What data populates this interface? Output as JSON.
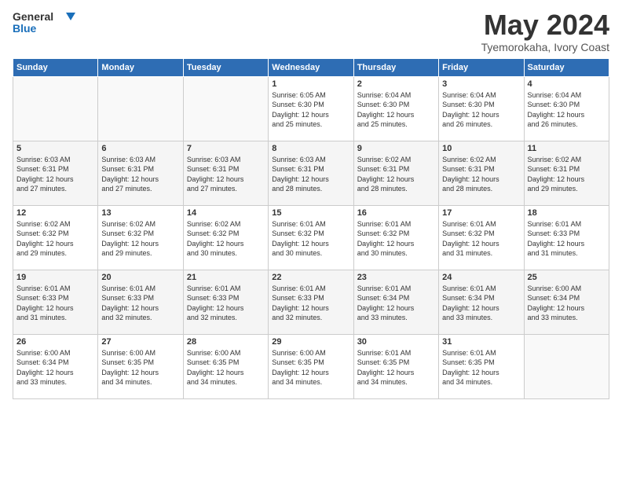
{
  "header": {
    "logo_line1": "General",
    "logo_line2": "Blue",
    "title": "May 2024",
    "subtitle": "Tyemorokaha, Ivory Coast"
  },
  "days_of_week": [
    "Sunday",
    "Monday",
    "Tuesday",
    "Wednesday",
    "Thursday",
    "Friday",
    "Saturday"
  ],
  "weeks": [
    [
      {
        "day": "",
        "content": ""
      },
      {
        "day": "",
        "content": ""
      },
      {
        "day": "",
        "content": ""
      },
      {
        "day": "1",
        "content": "Sunrise: 6:05 AM\nSunset: 6:30 PM\nDaylight: 12 hours\nand 25 minutes."
      },
      {
        "day": "2",
        "content": "Sunrise: 6:04 AM\nSunset: 6:30 PM\nDaylight: 12 hours\nand 25 minutes."
      },
      {
        "day": "3",
        "content": "Sunrise: 6:04 AM\nSunset: 6:30 PM\nDaylight: 12 hours\nand 26 minutes."
      },
      {
        "day": "4",
        "content": "Sunrise: 6:04 AM\nSunset: 6:30 PM\nDaylight: 12 hours\nand 26 minutes."
      }
    ],
    [
      {
        "day": "5",
        "content": "Sunrise: 6:03 AM\nSunset: 6:31 PM\nDaylight: 12 hours\nand 27 minutes."
      },
      {
        "day": "6",
        "content": "Sunrise: 6:03 AM\nSunset: 6:31 PM\nDaylight: 12 hours\nand 27 minutes."
      },
      {
        "day": "7",
        "content": "Sunrise: 6:03 AM\nSunset: 6:31 PM\nDaylight: 12 hours\nand 27 minutes."
      },
      {
        "day": "8",
        "content": "Sunrise: 6:03 AM\nSunset: 6:31 PM\nDaylight: 12 hours\nand 28 minutes."
      },
      {
        "day": "9",
        "content": "Sunrise: 6:02 AM\nSunset: 6:31 PM\nDaylight: 12 hours\nand 28 minutes."
      },
      {
        "day": "10",
        "content": "Sunrise: 6:02 AM\nSunset: 6:31 PM\nDaylight: 12 hours\nand 28 minutes."
      },
      {
        "day": "11",
        "content": "Sunrise: 6:02 AM\nSunset: 6:31 PM\nDaylight: 12 hours\nand 29 minutes."
      }
    ],
    [
      {
        "day": "12",
        "content": "Sunrise: 6:02 AM\nSunset: 6:32 PM\nDaylight: 12 hours\nand 29 minutes."
      },
      {
        "day": "13",
        "content": "Sunrise: 6:02 AM\nSunset: 6:32 PM\nDaylight: 12 hours\nand 29 minutes."
      },
      {
        "day": "14",
        "content": "Sunrise: 6:02 AM\nSunset: 6:32 PM\nDaylight: 12 hours\nand 30 minutes."
      },
      {
        "day": "15",
        "content": "Sunrise: 6:01 AM\nSunset: 6:32 PM\nDaylight: 12 hours\nand 30 minutes."
      },
      {
        "day": "16",
        "content": "Sunrise: 6:01 AM\nSunset: 6:32 PM\nDaylight: 12 hours\nand 30 minutes."
      },
      {
        "day": "17",
        "content": "Sunrise: 6:01 AM\nSunset: 6:32 PM\nDaylight: 12 hours\nand 31 minutes."
      },
      {
        "day": "18",
        "content": "Sunrise: 6:01 AM\nSunset: 6:33 PM\nDaylight: 12 hours\nand 31 minutes."
      }
    ],
    [
      {
        "day": "19",
        "content": "Sunrise: 6:01 AM\nSunset: 6:33 PM\nDaylight: 12 hours\nand 31 minutes."
      },
      {
        "day": "20",
        "content": "Sunrise: 6:01 AM\nSunset: 6:33 PM\nDaylight: 12 hours\nand 32 minutes."
      },
      {
        "day": "21",
        "content": "Sunrise: 6:01 AM\nSunset: 6:33 PM\nDaylight: 12 hours\nand 32 minutes."
      },
      {
        "day": "22",
        "content": "Sunrise: 6:01 AM\nSunset: 6:33 PM\nDaylight: 12 hours\nand 32 minutes."
      },
      {
        "day": "23",
        "content": "Sunrise: 6:01 AM\nSunset: 6:34 PM\nDaylight: 12 hours\nand 33 minutes."
      },
      {
        "day": "24",
        "content": "Sunrise: 6:01 AM\nSunset: 6:34 PM\nDaylight: 12 hours\nand 33 minutes."
      },
      {
        "day": "25",
        "content": "Sunrise: 6:00 AM\nSunset: 6:34 PM\nDaylight: 12 hours\nand 33 minutes."
      }
    ],
    [
      {
        "day": "26",
        "content": "Sunrise: 6:00 AM\nSunset: 6:34 PM\nDaylight: 12 hours\nand 33 minutes."
      },
      {
        "day": "27",
        "content": "Sunrise: 6:00 AM\nSunset: 6:35 PM\nDaylight: 12 hours\nand 34 minutes."
      },
      {
        "day": "28",
        "content": "Sunrise: 6:00 AM\nSunset: 6:35 PM\nDaylight: 12 hours\nand 34 minutes."
      },
      {
        "day": "29",
        "content": "Sunrise: 6:00 AM\nSunset: 6:35 PM\nDaylight: 12 hours\nand 34 minutes."
      },
      {
        "day": "30",
        "content": "Sunrise: 6:01 AM\nSunset: 6:35 PM\nDaylight: 12 hours\nand 34 minutes."
      },
      {
        "day": "31",
        "content": "Sunrise: 6:01 AM\nSunset: 6:35 PM\nDaylight: 12 hours\nand 34 minutes."
      },
      {
        "day": "",
        "content": ""
      }
    ]
  ]
}
